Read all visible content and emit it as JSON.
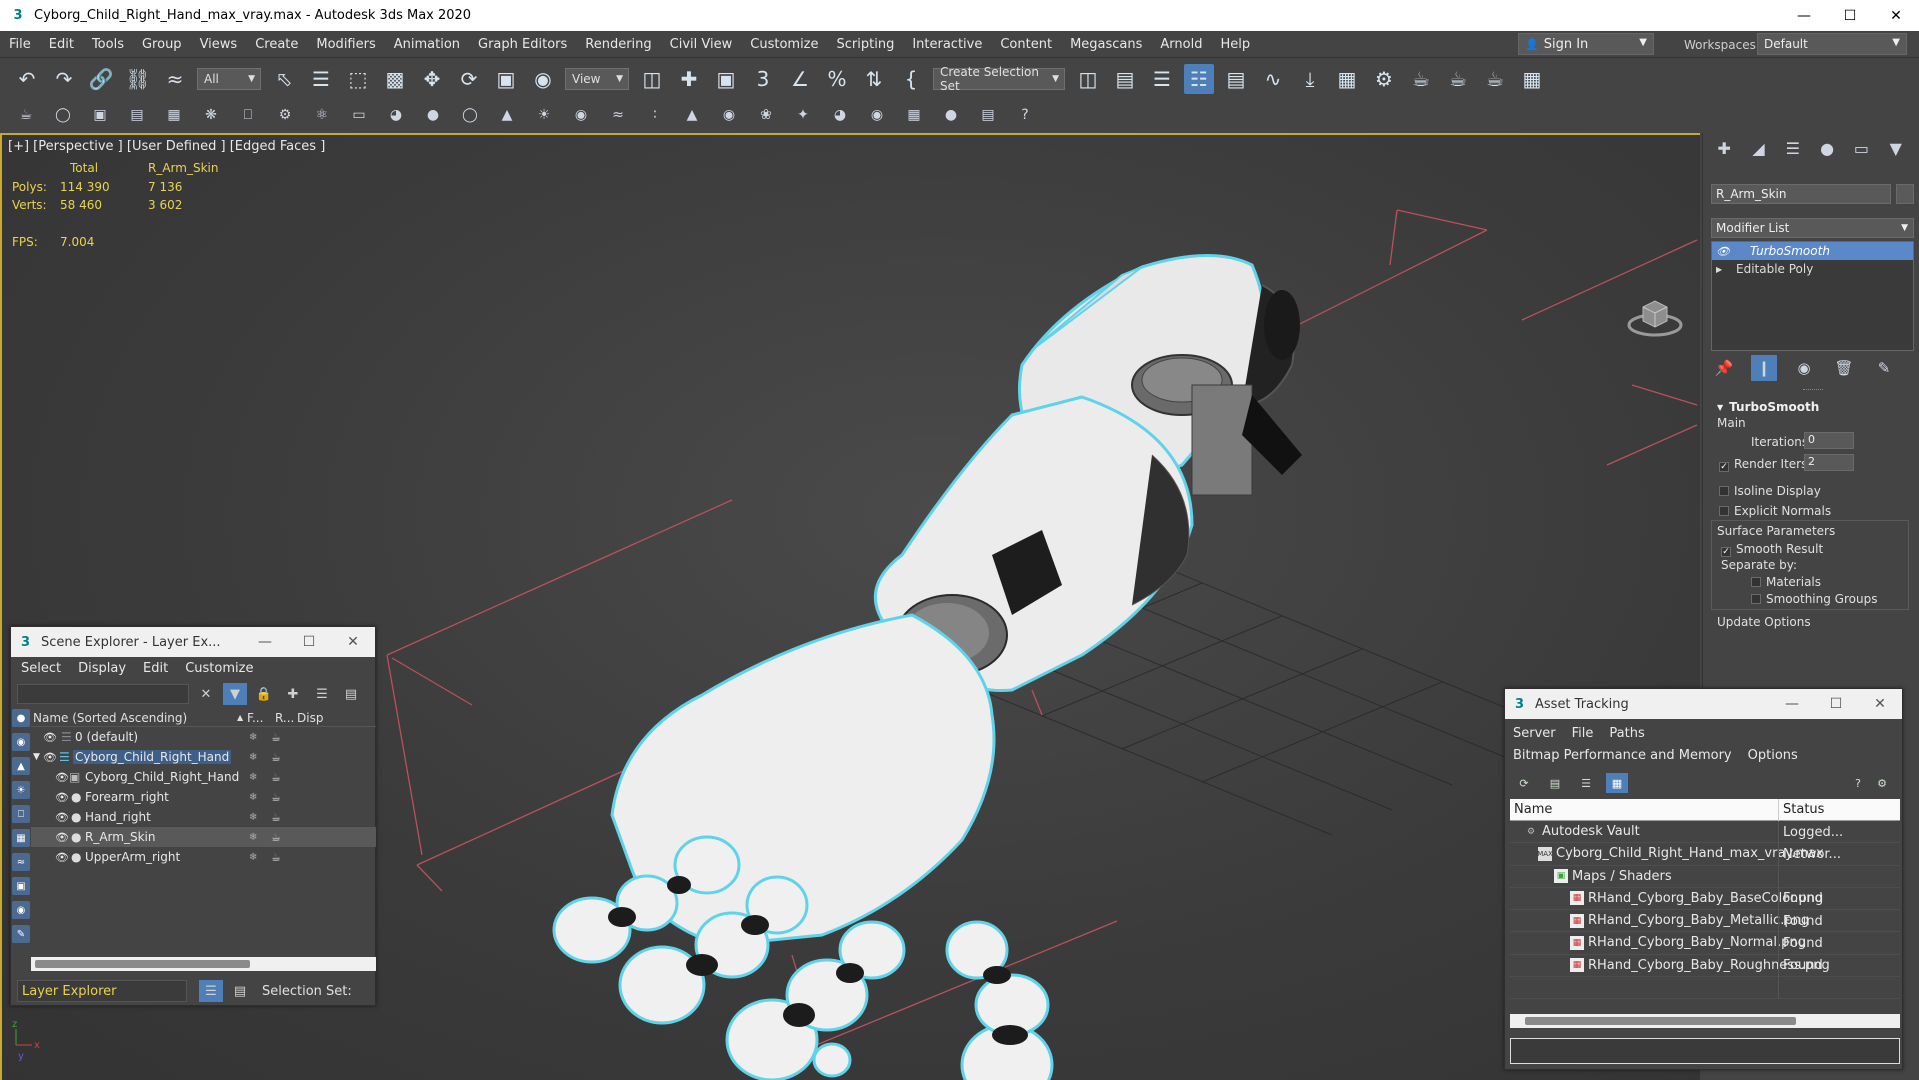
{
  "window": {
    "title": "Cyborg_Child_Right_Hand_max_vray.max - Autodesk 3ds Max 2020",
    "app_icon": "3"
  },
  "menubar": {
    "items": [
      "File",
      "Edit",
      "Tools",
      "Group",
      "Views",
      "Create",
      "Modifiers",
      "Animation",
      "Graph Editors",
      "Rendering",
      "Civil View",
      "Customize",
      "Scripting",
      "Interactive",
      "Content",
      "Megascans",
      "Arnold",
      "Help"
    ],
    "signin_label": "Sign In",
    "workspaces_label": "Workspaces:",
    "workspaces_value": "Default"
  },
  "toolbar": {
    "selection_filter": "All",
    "ref_coord": "View",
    "selection_set": "Create Selection Set"
  },
  "viewport": {
    "label": "[+] [Perspective ] [User Defined ] [Edged Faces ]",
    "stats_header_total": "Total",
    "stats_header_obj": "R_Arm_Skin",
    "polys_label": "Polys:",
    "polys_total": "114 390",
    "polys_obj": "7 136",
    "verts_label": "Verts:",
    "verts_total": "58 460",
    "verts_obj": "3 602",
    "fps_label": "FPS:",
    "fps_value": "7.004"
  },
  "command_panel": {
    "object_name": "R_Arm_Skin",
    "modifier_list": "Modifier List",
    "stack": [
      "TurboSmooth",
      "Editable Poly"
    ],
    "rollout_title": "TurboSmooth",
    "main_label": "Main",
    "iterations_label": "Iterations:",
    "iterations_value": "0",
    "render_iters_label": "Render Iters:",
    "render_iters_value": "2",
    "isoline_label": "Isoline Display",
    "explicit_normals_label": "Explicit Normals",
    "surface_params_label": "Surface Parameters",
    "smooth_result_label": "Smooth Result",
    "separate_by_label": "Separate by:",
    "materials_label": "Materials",
    "smoothing_groups_label": "Smoothing Groups",
    "update_options_label": "Update Options"
  },
  "scene_explorer": {
    "title": "Scene Explorer - Layer Ex...",
    "menu": [
      "Select",
      "Display",
      "Edit",
      "Customize"
    ],
    "col_name": "Name (Sorted Ascending)",
    "col_freeze": "F...",
    "col_render": "R...",
    "col_display": "Disp",
    "rows": [
      {
        "name": "0 (default)"
      },
      {
        "name": "Cyborg_Child_Right_Hand"
      },
      {
        "name": "Cyborg_Child_Right_Hand"
      },
      {
        "name": "Forearm_right"
      },
      {
        "name": "Hand_right"
      },
      {
        "name": "R_Arm_Skin"
      },
      {
        "name": "UpperArm_right"
      }
    ],
    "footer_layer": "Layer Explorer",
    "footer_selset": "Selection Set:"
  },
  "asset_tracking": {
    "title": "Asset Tracking",
    "menu": [
      "Server",
      "File",
      "Paths",
      "Bitmap Performance and Memory",
      "Options"
    ],
    "col_name": "Name",
    "col_status": "Status",
    "rows": [
      {
        "name": "Autodesk Vault",
        "status": "Logged..."
      },
      {
        "name": "Cyborg_Child_Right_Hand_max_vray.max",
        "status": "Networ..."
      },
      {
        "name": "Maps / Shaders",
        "status": ""
      },
      {
        "name": "RHand_Cyborg_Baby_BaseColor.png",
        "status": "Found"
      },
      {
        "name": "RHand_Cyborg_Baby_Metallic.png",
        "status": "Found"
      },
      {
        "name": "RHand_Cyborg_Baby_Normal.png",
        "status": "Found"
      },
      {
        "name": "RHand_Cyborg_Baby_Roughness.png",
        "status": "Found"
      }
    ]
  },
  "colors": {
    "accent": "#4f7fb8",
    "selection_outline": "#5fd3ea",
    "stats_text": "#e8d44a",
    "grid_red": "#b9505d"
  }
}
